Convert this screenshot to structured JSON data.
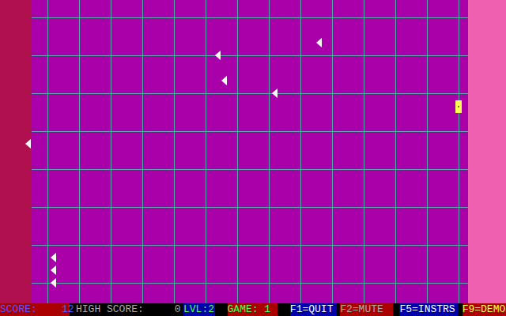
{
  "field": {
    "enemies": [
      {
        "kind": "arrow"
      },
      {
        "kind": "arrow"
      },
      {
        "kind": "arrow"
      },
      {
        "kind": "arrow"
      },
      {
        "kind": "arrow"
      },
      {
        "kind": "arrow"
      },
      {
        "kind": "arrow"
      },
      {
        "kind": "arrow"
      }
    ],
    "player": {
      "kind": "ship"
    }
  },
  "status_bar": [
    {
      "text": "SCORE:    12",
      "color": "#5555ff",
      "background": "#aa0000"
    },
    {
      "text": "HIGH SCORE:     0",
      "color": "#aaaaaa",
      "background": "#000000"
    },
    {
      "text": "LVL:2",
      "color": "#55ff55",
      "background": "#0000aa"
    },
    {
      "text": "GAME: 1",
      "color": "#55ff55",
      "background": "#aa0000"
    },
    {
      "text": "F1=QUIT",
      "color": "#ffffff",
      "background": "#0000aa"
    },
    {
      "text": "F2=MUTE",
      "color": "#aaaaaa",
      "background": "#aa0000"
    },
    {
      "text": "F5=INSTRS",
      "color": "#ffffff",
      "background": "#0000aa"
    },
    {
      "text": "F9=DEMO",
      "color": "#ffff55",
      "background": "#aa0000"
    }
  ]
}
